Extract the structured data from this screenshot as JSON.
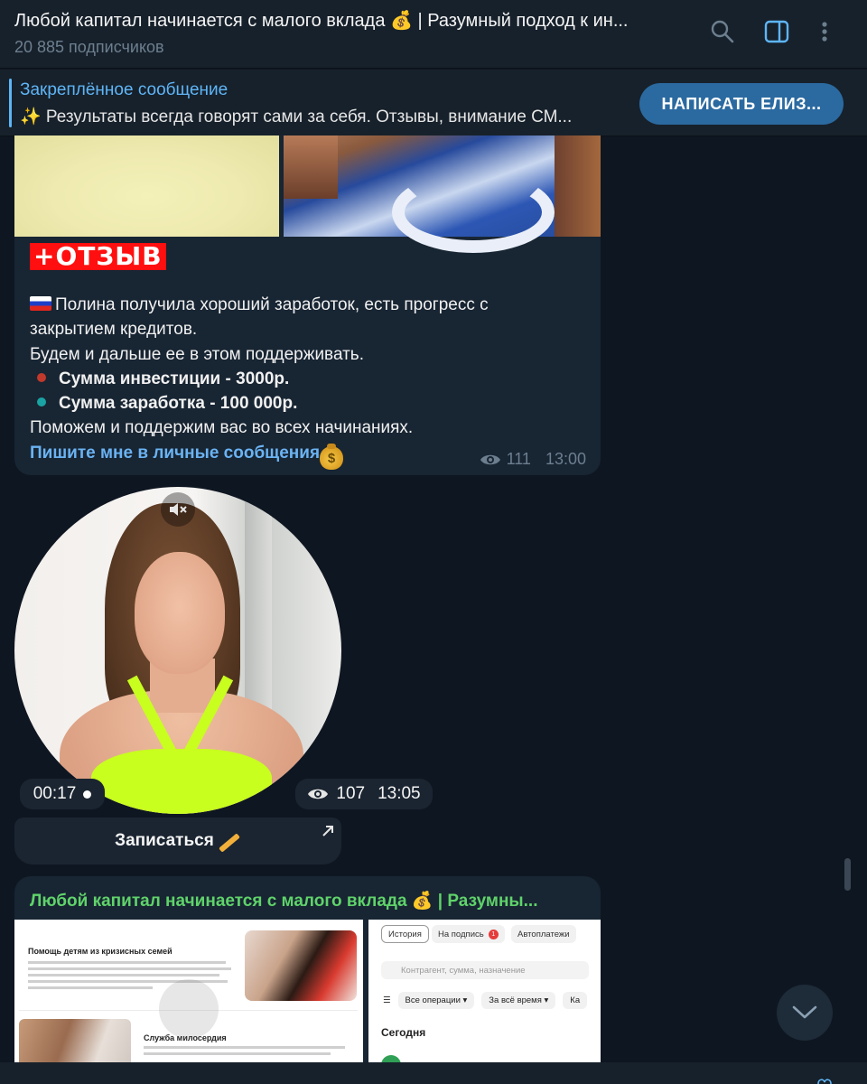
{
  "header": {
    "title": "Любой капитал начинается с малого вклада 💰 | Разумный подход к ин...",
    "subscribers": "20 885 подписчиков"
  },
  "pinned": {
    "title": "Закреплённое сообщение",
    "text": "✨ Результаты всегда говорят сами за себя. Отзывы, внимание СМ...",
    "button": "НАПИСАТЬ ЕЛИЗ..."
  },
  "message1": {
    "badge": "+ОТЗЫВ",
    "line1": "Полина получила хороший заработок, есть прогресс с закрытием кредитов.",
    "line2": "Будем и дальше ее в этом поддерживать.",
    "bullet1": "Сумма инвестиции - 3000р.",
    "bullet2": "Сумма заработка - 100 000р.",
    "line3": "Поможем и поддержим вас во всех начинаниях.",
    "link": "Пишите мне в личные сообщения",
    "views": "111",
    "time": "13:00",
    "bullet1_color": "#c0392b",
    "bullet2_color": "#1aa3a3"
  },
  "video_message": {
    "duration": "00:17",
    "views": "107",
    "time": "13:05"
  },
  "signup_button": "Записаться",
  "forwarded": {
    "title": "Любой капитал начинается с малого вклада 💰 | Разумны...",
    "left_shot": {
      "heading1": "Помощь детям из кризисных семей",
      "heading2": "Служба милосердия"
    },
    "right_shot": {
      "tab1": "История",
      "tab2": "На подпись",
      "tab2_badge": "1",
      "tab3": "Автоплатежи",
      "search_placeholder": "Контрагент, сумма, назначение",
      "filter1": "Все операции",
      "filter2": "За всё время",
      "filter3": "Ка",
      "today": "Сегодня"
    }
  },
  "colors": {
    "accent": "#5eb5f7",
    "link": "#6ab3f3",
    "forward_title": "#5fd36a",
    "badge_bg": "#ff0f0f"
  }
}
